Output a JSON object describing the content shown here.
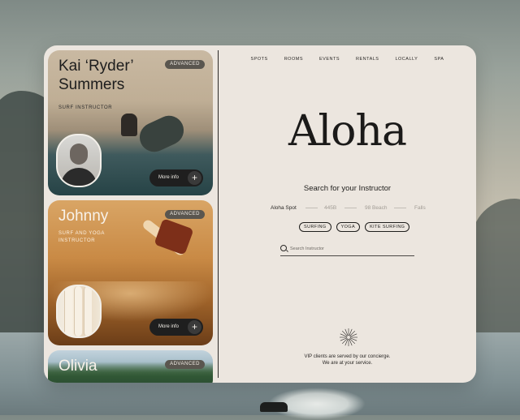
{
  "instructors": [
    {
      "name": "Kai ‘Ryder’ Summers",
      "level": "ADVANCED",
      "role": "SURF INSTRUCTOR",
      "more_label": "More info",
      "plus_label": "+"
    },
    {
      "name": "Johnny",
      "level": "ADVANCED",
      "role": "SURF AND YOGA INSTRUCTOR",
      "more_label": "More info",
      "plus_label": "+"
    },
    {
      "name": "Olivia",
      "level": "ADVANCED"
    }
  ],
  "nav": [
    "SPOTS",
    "ROOMS",
    "EVENTS",
    "RENTALS",
    "LOCALLY",
    "SPA"
  ],
  "brand_title": "Aloha",
  "search_heading": "Search for your Instructor",
  "spots": [
    "Aloha Spot",
    "445B",
    "98 Beach",
    "Falls"
  ],
  "chips": [
    "SURFING",
    "YOGA",
    "KITE SURFING"
  ],
  "search": {
    "placeholder": "Search Instructor",
    "value": ""
  },
  "concierge": [
    "VIP clients are served by our concierge.",
    "We are at your service."
  ],
  "icons": {
    "search": "search-icon",
    "plus": "plus-icon",
    "sunburst": "sunburst-icon"
  },
  "colors": {
    "panel": "#ece6df",
    "dark": "#1f1f1f",
    "badge": "#5a564f"
  }
}
